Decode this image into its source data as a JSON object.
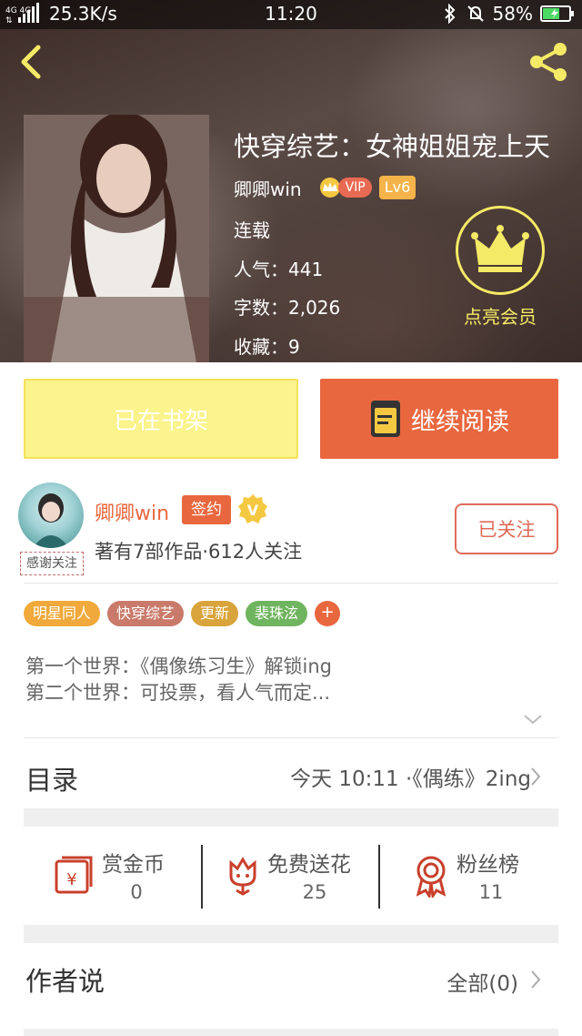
{
  "status_bar": {
    "network": "4G 4G",
    "speed": "25.3K/s",
    "time": "11:20",
    "battery": "58%",
    "icons": [
      "bluetooth-icon",
      "mute-bell-icon",
      "battery-charging-icon"
    ]
  },
  "book": {
    "title": "快穿综艺：女神姐姐宠上天",
    "author": "卿卿win",
    "vip": "VIP",
    "level": "Lv6",
    "status": "连载",
    "popularity": "人气：441",
    "word_count": "字数：2,026",
    "favorites": "收藏：9"
  },
  "member": {
    "label": "点亮会员"
  },
  "actions": {
    "shelf_label": "已在书架",
    "read_label": "继续阅读"
  },
  "author": {
    "name": "卿卿win",
    "signed": "签约",
    "verified": "V",
    "stats": "著有7部作品·612人关注",
    "follow_label": "已关注",
    "thanks_tag": "感谢关注"
  },
  "tags": [
    {
      "label": "明星同人",
      "color": "#f0a93a"
    },
    {
      "label": "快穿综艺",
      "color": "#c97a6a"
    },
    {
      "label": "更新",
      "color": "#d9a43c"
    },
    {
      "label": "裴珠泫",
      "color": "#6fb45e"
    }
  ],
  "add_tag": "+",
  "synopsis": {
    "line1": "第一个世界：《偶像练习生》解锁ing",
    "line2": "第二个世界：可投票，看人气而定..."
  },
  "catalog": {
    "title": "目录",
    "latest": "今天 10:11 ·《偶练》2ing"
  },
  "stats": [
    {
      "label": "赏金币",
      "value": "0",
      "icon": "red-envelope-icon"
    },
    {
      "label": "免费送花",
      "value": "25",
      "icon": "flower-icon"
    },
    {
      "label": "粉丝榜",
      "value": "11",
      "icon": "medal-icon"
    }
  ],
  "author_say": {
    "title": "作者说",
    "all_label": "全部(0)"
  },
  "colors": {
    "accent": "#e9673f",
    "member_yellow": "#f5ea66",
    "shelf_yellow": "#fbf38b"
  }
}
